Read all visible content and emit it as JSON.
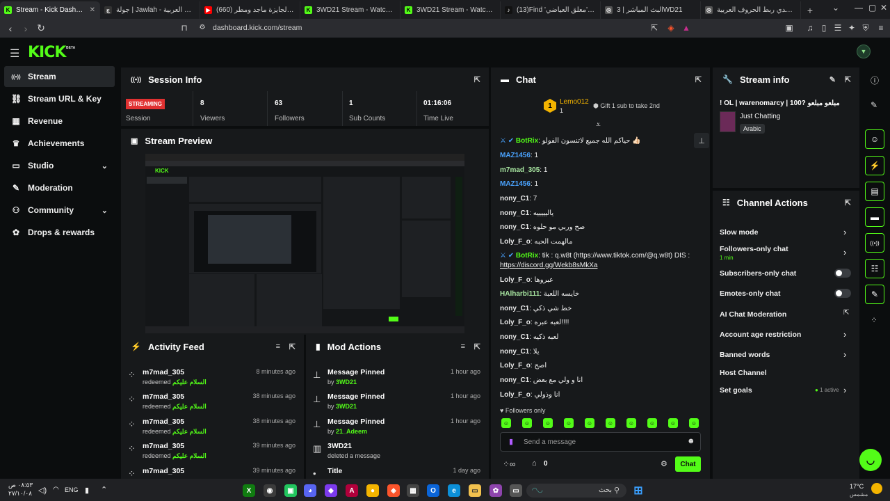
{
  "browser": {
    "tabs": [
      {
        "title": "Stream - Kick Dashboard",
        "active": true
      },
      {
        "title": "جولة | Jawlah - منصة الألعاب العربية"
      },
      {
        "title": "(660) يستاهل الجايزة ماجد ومطر"
      },
      {
        "title": "3WD21 Stream - Watch Live"
      },
      {
        "title": "3WD21 Stream - Watch Live on"
      },
      {
        "title": "(13)Find 'معلق العياضي' on TikTok"
      },
      {
        "title": "البث المباشر | 3WD21"
      },
      {
        "title": "تحدي ربط الحروف العربية - PRO"
      }
    ],
    "url": "dashboard.kick.com/stream"
  },
  "app": {
    "logo": "KICK",
    "beta": "BETA"
  },
  "sidebar": {
    "items": [
      {
        "label": "Stream",
        "icon": "broadcast-icon",
        "glyph": "((•))",
        "active": true
      },
      {
        "label": "Stream URL & Key",
        "icon": "link-icon",
        "glyph": "🔗"
      },
      {
        "label": "Revenue",
        "icon": "chart-icon",
        "glyph": "▦"
      },
      {
        "label": "Achievements",
        "icon": "trophy-icon",
        "glyph": "🏆"
      },
      {
        "label": "Studio",
        "icon": "studio-icon",
        "glyph": "▭",
        "chevron": "⌄"
      },
      {
        "label": "Moderation",
        "icon": "wrench-icon",
        "glyph": "🔧"
      },
      {
        "label": "Community",
        "icon": "community-icon",
        "glyph": "👥",
        "chevron": "⌄"
      },
      {
        "label": "Drops & rewards",
        "icon": "gift-icon",
        "glyph": "🎁"
      }
    ]
  },
  "session": {
    "title": "Session Info",
    "status": "STREAMING",
    "status_label": "Session",
    "stats": [
      {
        "value": "8",
        "label": "Viewers"
      },
      {
        "value": "63",
        "label": "Followers"
      },
      {
        "value": "1",
        "label": "Sub Counts"
      },
      {
        "value": "01:16:06",
        "label": "Time Live"
      }
    ]
  },
  "preview": {
    "title": "Stream Preview"
  },
  "activity": {
    "title": "Activity Feed",
    "rows": [
      {
        "name": "m7mad_305",
        "action": "redeemed",
        "reward": "السلام عليكم",
        "time": "8 minutes ago"
      },
      {
        "name": "m7mad_305",
        "action": "redeemed",
        "reward": "السلام عليكم",
        "time": "38 minutes ago"
      },
      {
        "name": "m7mad_305",
        "action": "redeemed",
        "reward": "السلام عليكم",
        "time": "38 minutes ago"
      },
      {
        "name": "m7mad_305",
        "action": "redeemed",
        "reward": "السلام عليكم",
        "time": "39 minutes ago"
      },
      {
        "name": "m7mad_305",
        "action": "",
        "reward": "",
        "time": "39 minutes ago"
      }
    ]
  },
  "mod": {
    "title": "Mod Actions",
    "rows": [
      {
        "name": "Message Pinned",
        "by": "by",
        "who": "3WD21",
        "time": "1 hour ago",
        "glyph": "📌"
      },
      {
        "name": "Message Pinned",
        "by": "by",
        "who": "3WD21",
        "time": "1 hour ago",
        "glyph": "📌"
      },
      {
        "name": "Message Pinned",
        "by": "by",
        "who": "21_Adeem",
        "time": "1 hour ago",
        "glyph": "📌"
      },
      {
        "name": "3WD21",
        "by": "deleted a message",
        "who": "",
        "time": "",
        "glyph": "🗑"
      },
      {
        "name": "Title",
        "by": "",
        "who": "",
        "time": "1 day ago",
        "glyph": "•"
      }
    ]
  },
  "chat": {
    "title": "Chat",
    "top_user": "Lemo012",
    "top_count": "1",
    "gift_text": "Gift 1 sub to take 2nd",
    "messages": [
      {
        "user": "BotRix",
        "color": "#53fc18",
        "text": "حياكم الله جميع لاتنسون الفولو 👍🏻",
        "badges": true
      },
      {
        "user": "MAZ1456",
        "color": "#4aa3ff",
        "text": "1"
      },
      {
        "user": "m7mad_305",
        "color": "#a8e6a1",
        "text": "1"
      },
      {
        "user": "MAZ1456",
        "color": "#4aa3ff",
        "text": "1"
      },
      {
        "user": "nony_C1",
        "color": "#e8e8e8",
        "text": "7"
      },
      {
        "user": "nony_C1",
        "color": "#e8e8e8",
        "text": "ياليييييه"
      },
      {
        "user": "nony_C1",
        "color": "#e8e8e8",
        "text": "صح وربي مو حلوه"
      },
      {
        "user": "Loly_F_o",
        "color": "#e8e8e8",
        "text": "مالهمت الحبه"
      },
      {
        "user": "BotRix",
        "color": "#53fc18",
        "text": "tik : q.w8t (https://www.tiktok.com/@q.w8t) DIS :",
        "text2": "https://discord.gg/Wekb8sMkXa",
        "badges": true
      },
      {
        "user": "Loly_F_o",
        "color": "#e8e8e8",
        "text": "عبروها"
      },
      {
        "user": "HAlharbi111",
        "color": "#a8e6a1",
        "text": "خايسه اللعبة"
      },
      {
        "user": "nony_C1",
        "color": "#e8e8e8",
        "text": "خط شي ذكي"
      },
      {
        "user": "Loly_F_o",
        "color": "#e8e8e8",
        "text": "لعبه عبره!!!!"
      },
      {
        "user": "nony_C1",
        "color": "#e8e8e8",
        "text": "لعبه ذكيه"
      },
      {
        "user": "nony_C1",
        "color": "#e8e8e8",
        "text": "يلا"
      },
      {
        "user": "Loly_F_o",
        "color": "#e8e8e8",
        "text": "اصح"
      },
      {
        "user": "nony_C1",
        "color": "#e8e8e8",
        "text": "انا و ولي مع بعض"
      },
      {
        "user": "Loly_F_o",
        "color": "#e8e8e8",
        "text": "انا وذولي"
      }
    ],
    "followers_only": "Followers only",
    "input_placeholder": "Send a message",
    "points": "0",
    "send_label": "Chat"
  },
  "stream_info": {
    "title": "Stream info",
    "stream_title": "! OL | warenomarcy | 100? مبلعو مبلعو",
    "category": "Just Chatting",
    "language": "Arabic"
  },
  "channel_actions": {
    "title": "Channel Actions",
    "items": [
      {
        "label": "Slow mode",
        "control": "chevron"
      },
      {
        "label": "Followers-only chat",
        "sub": "1 min",
        "control": "chevron"
      },
      {
        "label": "Subscribers-only chat",
        "control": "toggle"
      },
      {
        "label": "Emotes-only chat",
        "control": "toggle"
      },
      {
        "label": "AI Chat Moderation",
        "control": "external"
      },
      {
        "label": "Account age restriction",
        "control": "chevron"
      },
      {
        "label": "Banned words",
        "control": "chevron"
      },
      {
        "label": "Host Channel",
        "control": "none"
      },
      {
        "label": "Set goals",
        "sub": "1 active",
        "control": "chevron"
      }
    ]
  },
  "taskbar": {
    "time": "٠٨:٥٣ ص",
    "date": "٢٧/١٠/٠٨",
    "lang": "ENG",
    "search_placeholder": "بحث",
    "weather_temp": "17°C",
    "weather_desc": "مشمس"
  },
  "colors": {
    "accent": "#53fc18",
    "panel": "#17191b",
    "bg": "#0b0d0e",
    "live": "#e03131"
  }
}
